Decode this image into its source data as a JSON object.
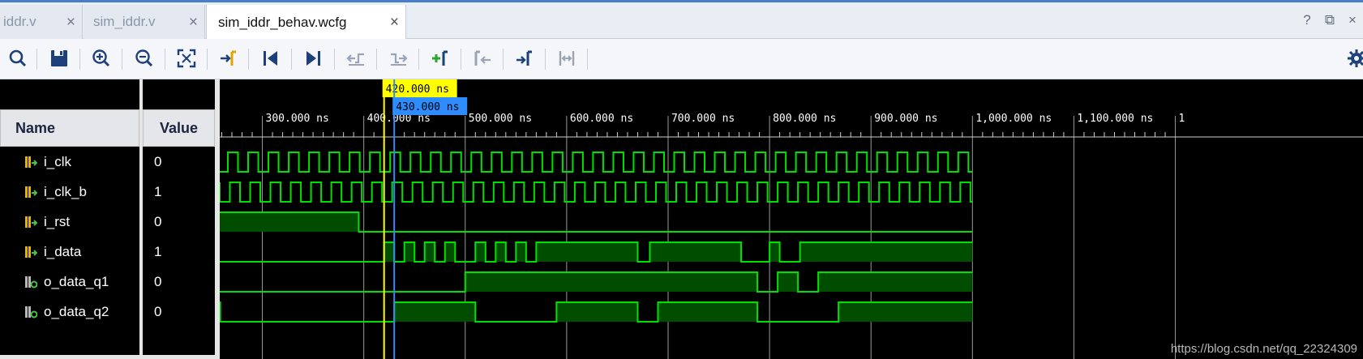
{
  "tabs": [
    {
      "label": "iddr.v",
      "active": false
    },
    {
      "label": "sim_iddr.v",
      "active": false
    },
    {
      "label": "sim_iddr_behav.wcfg",
      "active": true
    }
  ],
  "tab_close_glyph": "×",
  "window_icons": {
    "help": "?",
    "restore": "⧉",
    "close": "×"
  },
  "toolbar": {
    "icons": [
      "search-icon",
      "save-icon",
      "zoom-in-icon",
      "zoom-out-icon",
      "zoom-fit-icon",
      "go-to-cursor-icon",
      "go-to-start-icon",
      "go-to-end-icon",
      "previous-transition-icon",
      "next-transition-icon",
      "add-marker-icon",
      "previous-marker-icon",
      "next-marker-icon",
      "swap-cursors-icon",
      "settings-icon"
    ]
  },
  "columns": {
    "name": "Name",
    "value": "Value"
  },
  "signals": [
    {
      "name": "i_clk",
      "value": "0",
      "kind": "input"
    },
    {
      "name": "i_clk_b",
      "value": "1",
      "kind": "input"
    },
    {
      "name": "i_rst",
      "value": "0",
      "kind": "input"
    },
    {
      "name": "i_data",
      "value": "1",
      "kind": "input"
    },
    {
      "name": "o_data_q1",
      "value": "0",
      "kind": "output"
    },
    {
      "name": "o_data_q2",
      "value": "0",
      "kind": "output"
    }
  ],
  "timeline": {
    "range_ns": [
      258,
      1385
    ],
    "ticks": [
      {
        "t": 300,
        "label": "300.000 ns"
      },
      {
        "t": 400,
        "label": "400.000 ns"
      },
      {
        "t": 500,
        "label": "500.000 ns"
      },
      {
        "t": 600,
        "label": "600.000 ns"
      },
      {
        "t": 700,
        "label": "700.000 ns"
      },
      {
        "t": 800,
        "label": "800.000 ns"
      },
      {
        "t": 900,
        "label": "900.000 ns"
      },
      {
        "t": 1000,
        "label": "1,000.000 ns"
      },
      {
        "t": 1100,
        "label": "1,100.000 ns"
      },
      {
        "t": 1200,
        "label": "1"
      }
    ],
    "sim_end_ns": 1000
  },
  "cursors": [
    {
      "t": 420,
      "label": "420.000 ns",
      "color": "#ffff00",
      "text_color": "#000000"
    },
    {
      "t": 430,
      "label": "430.000 ns",
      "color": "#2f8cff",
      "text_color": "#000000"
    }
  ],
  "colors": {
    "wave": "#00e000",
    "wave_fill": "#004d00",
    "grid": "#9a9a9a",
    "plot_bg": "#000000"
  },
  "waves": {
    "i_clk": {
      "type": "clock",
      "period_ns": 20,
      "first_edge_ns": 266,
      "start_level": 0
    },
    "i_clk_b": {
      "type": "clock",
      "period_ns": 20,
      "first_edge_ns": 258,
      "start_level": 1
    },
    "i_rst": {
      "type": "bit",
      "edges": [
        [
          258,
          1
        ],
        [
          395,
          0
        ]
      ]
    },
    "i_data": {
      "type": "bit",
      "edges": [
        [
          258,
          0
        ],
        [
          420,
          1
        ],
        [
          430,
          0
        ],
        [
          440,
          1
        ],
        [
          450,
          0
        ],
        [
          460,
          1
        ],
        [
          470,
          0
        ],
        [
          480,
          1
        ],
        [
          490,
          0
        ],
        [
          510,
          1
        ],
        [
          520,
          0
        ],
        [
          530,
          1
        ],
        [
          540,
          0
        ],
        [
          550,
          1
        ],
        [
          560,
          0
        ],
        [
          570,
          1
        ],
        [
          670,
          0
        ],
        [
          682,
          1
        ],
        [
          772,
          0
        ],
        [
          800,
          1
        ],
        [
          810,
          0
        ],
        [
          830,
          1
        ]
      ]
    },
    "o_data_q1": {
      "type": "bit",
      "edges": [
        [
          258,
          0
        ],
        [
          500,
          1
        ],
        [
          788,
          0
        ],
        [
          808,
          1
        ],
        [
          828,
          0
        ],
        [
          848,
          1
        ]
      ]
    },
    "o_data_q2": {
      "type": "bit",
      "edges": [
        [
          258,
          1
        ],
        [
          258.5,
          0
        ],
        [
          430,
          1
        ],
        [
          510,
          0
        ],
        [
          590,
          1
        ],
        [
          670,
          0
        ],
        [
          690,
          1
        ],
        [
          788,
          0
        ],
        [
          868,
          1
        ]
      ]
    }
  },
  "watermark": "https://blog.csdn.net/qq_22324309"
}
